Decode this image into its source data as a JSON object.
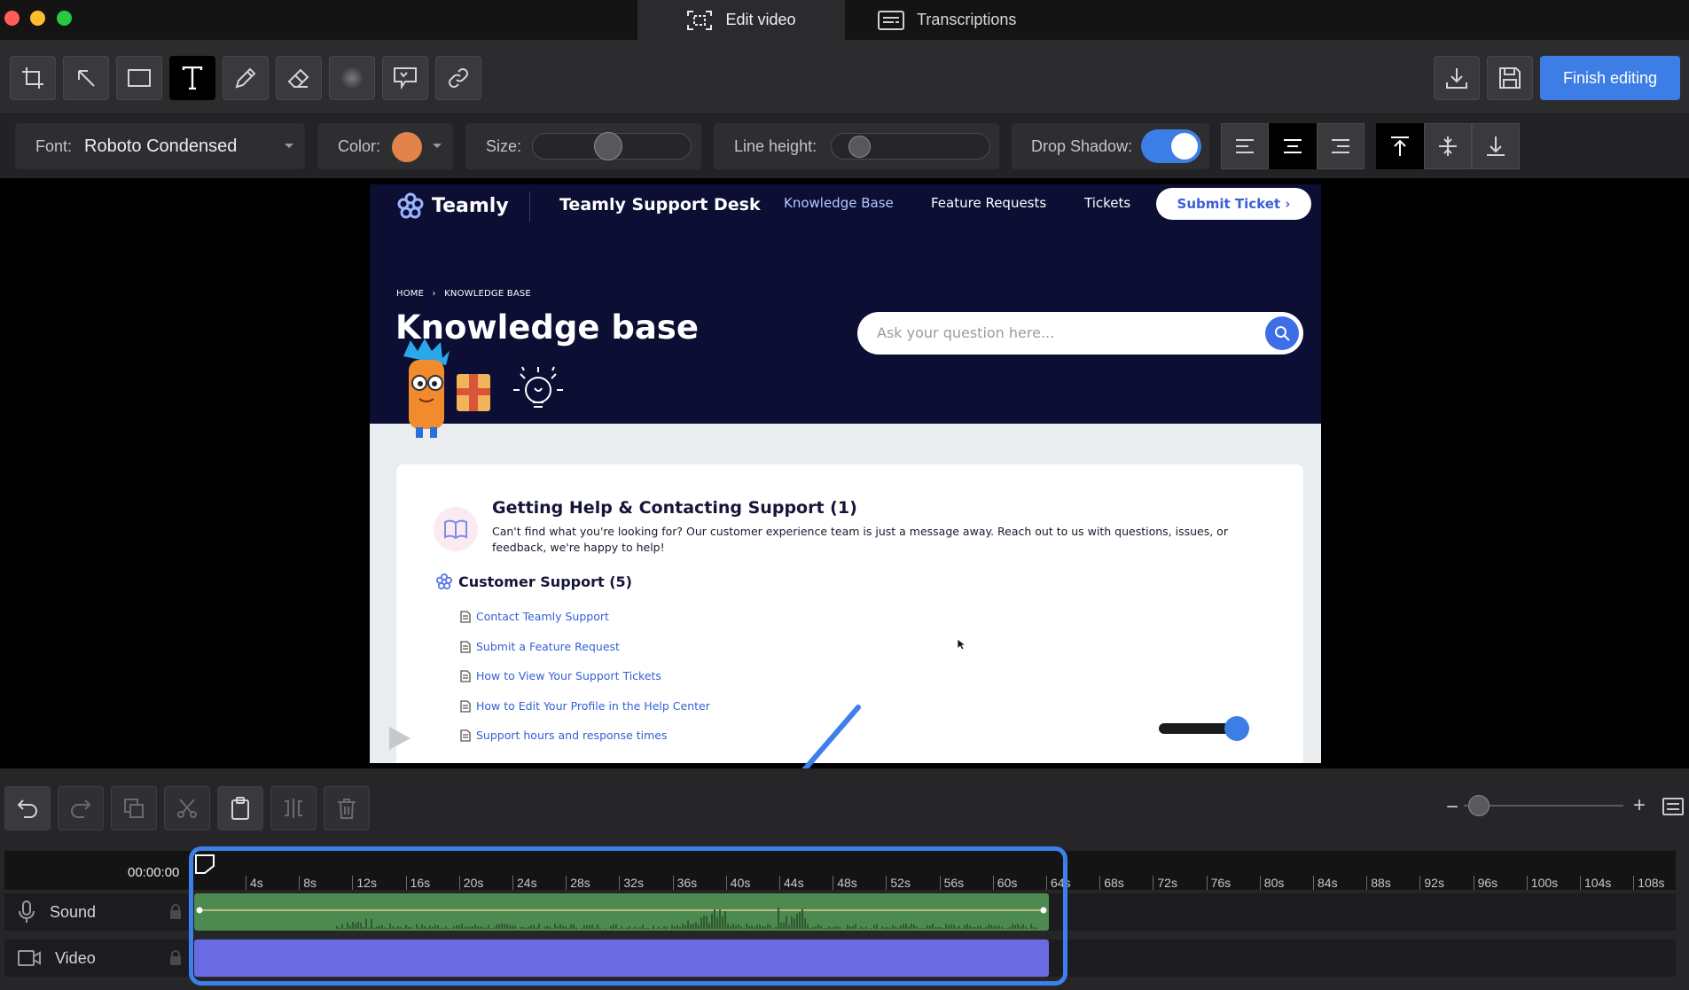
{
  "window": {
    "tabs": [
      {
        "label": "Edit video",
        "icon": "screen-capture-icon",
        "active": true
      },
      {
        "label": "Transcriptions",
        "icon": "transcript-icon",
        "active": false
      }
    ],
    "traffic_lights": [
      "#ff5f57",
      "#febc2e",
      "#28c840"
    ]
  },
  "toolbar": {
    "tools": [
      "crop-icon",
      "arrow-icon",
      "rectangle-icon",
      "text-icon",
      "pen-icon",
      "eraser-icon",
      "blur-icon",
      "speech-bubble-icon",
      "link-icon"
    ],
    "selected_tool": "text-icon",
    "actions": [
      "download-icon",
      "save-icon"
    ],
    "finish_label": "Finish editing"
  },
  "properties": {
    "font_label": "Font:",
    "font_value": "Roboto Condensed",
    "color_label": "Color:",
    "color_value": "#e2834a",
    "size_label": "Size:",
    "line_height_label": "Line height:",
    "drop_shadow_label": "Drop Shadow:",
    "drop_shadow_on": true,
    "align_options": [
      "align-left-icon",
      "align-center-icon",
      "align-right-icon"
    ],
    "align_selected": "align-center-icon",
    "valign_options": [
      "align-top-icon",
      "align-middle-icon",
      "align-bottom-icon"
    ],
    "valign_selected": "align-top-icon"
  },
  "preview": {
    "brand": "Teamly",
    "desk_title": "Teamly Support Desk",
    "nav": [
      "Knowledge Base",
      "Feature Requests",
      "Tickets"
    ],
    "submit_label": "Submit Ticket ›",
    "breadcrumb_home": "HOME",
    "breadcrumb_sep": "›",
    "breadcrumb_current": "KNOWLEDGE BASE",
    "page_title": "Knowledge base",
    "search_placeholder": "Ask your question here...",
    "section_title": "Getting Help & Contacting Support (1)",
    "section_desc": "Can't find what you're looking for? Our customer experience team is just a message away. Reach out to us with questions, issues, or feedback, we're happy to help!",
    "category_title": "Customer Support (5)",
    "articles": [
      "Contact Teamly Support",
      "Submit a Feature Request",
      "How to View Your Support Tickets",
      "How to Edit Your Profile in the Help Center",
      "Support hours and response times"
    ]
  },
  "edit_tools": [
    "undo-icon",
    "redo-icon",
    "copy-icon",
    "cut-icon",
    "paste-icon",
    "split-icon",
    "delete-icon"
  ],
  "zoom": {
    "minus": "−",
    "plus": "+"
  },
  "timeline": {
    "timecode": "00:00:00",
    "ticks": [
      "4s",
      "8s",
      "12s",
      "16s",
      "20s",
      "24s",
      "28s",
      "32s",
      "36s",
      "40s",
      "44s",
      "48s",
      "52s",
      "56s",
      "60s",
      "64s",
      "68s",
      "72s",
      "76s",
      "80s",
      "84s",
      "88s",
      "92s",
      "96s",
      "100s",
      "104s",
      "108s"
    ],
    "tracks": [
      {
        "label": "Sound",
        "icon": "microphone-icon"
      },
      {
        "label": "Video",
        "icon": "video-camera-icon"
      }
    ]
  }
}
